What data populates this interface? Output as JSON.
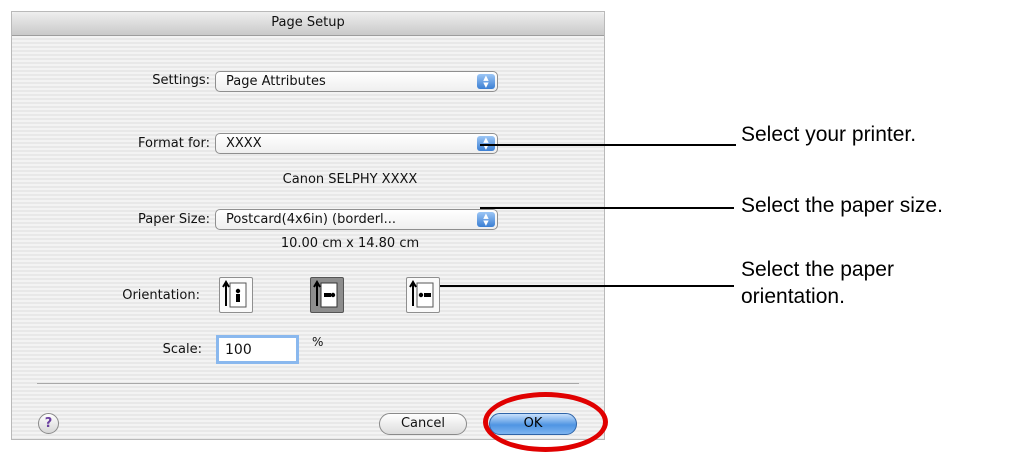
{
  "dialog": {
    "title": "Page Setup",
    "settings": {
      "label": "Settings:",
      "value": "Page Attributes"
    },
    "format_for": {
      "label": "Format for:",
      "value": "XXXX",
      "subtext": "Canon SELPHY XXXX"
    },
    "paper_size": {
      "label": "Paper Size:",
      "value": "Postcard(4x6in) (borderl...",
      "subtext": "10.00 cm x 14.80 cm"
    },
    "orientation": {
      "label": "Orientation:",
      "selected": "landscape"
    },
    "scale": {
      "label": "Scale:",
      "value": "100",
      "unit": "%"
    },
    "help_label": "?",
    "cancel_label": "Cancel",
    "ok_label": "OK"
  },
  "callouts": {
    "printer": "Select your printer.",
    "paper_size": "Select the paper size.",
    "orientation_line1": "Select the paper",
    "orientation_line2": "orientation."
  },
  "colors": {
    "highlight_ring": "#e00000",
    "accent": "#3b7fd3"
  }
}
